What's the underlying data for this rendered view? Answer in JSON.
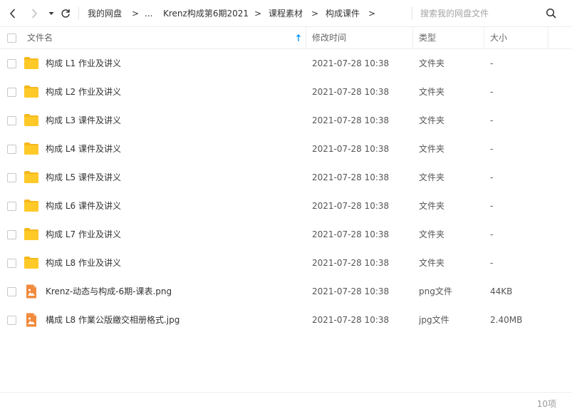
{
  "nav": {
    "back_icon": "chevron-left-icon",
    "forward_icon": "chevron-right-icon",
    "history_icon": "caret-down-icon",
    "refresh_icon": "refresh-icon"
  },
  "breadcrumb": {
    "items": [
      "我的网盘",
      "...",
      "Krenz构成第6期2021",
      "课程素材",
      "构成课件"
    ],
    "separator": ">"
  },
  "search": {
    "placeholder": "搜索我的网盘文件",
    "icon": "search-icon"
  },
  "columns": {
    "name": "文件名",
    "mtime": "修改时间",
    "type": "类型",
    "size": "大小",
    "sort_icon": "sort-ascending-arrow-icon"
  },
  "files": [
    {
      "name": "构成 L1 作业及讲义",
      "mtime": "2021-07-28 10:38",
      "type": "文件夹",
      "size": "-",
      "icon": "folder-icon"
    },
    {
      "name": "构成 L2 作业及讲义",
      "mtime": "2021-07-28 10:38",
      "type": "文件夹",
      "size": "-",
      "icon": "folder-icon"
    },
    {
      "name": "构成 L3 课件及讲义",
      "mtime": "2021-07-28 10:38",
      "type": "文件夹",
      "size": "-",
      "icon": "folder-icon"
    },
    {
      "name": "构成 L4 课件及讲义",
      "mtime": "2021-07-28 10:38",
      "type": "文件夹",
      "size": "-",
      "icon": "folder-icon"
    },
    {
      "name": "构成 L5 课件及讲义",
      "mtime": "2021-07-28 10:38",
      "type": "文件夹",
      "size": "-",
      "icon": "folder-icon"
    },
    {
      "name": "构成 L6 课件及讲义",
      "mtime": "2021-07-28 10:38",
      "type": "文件夹",
      "size": "-",
      "icon": "folder-icon"
    },
    {
      "name": "构成 L7 作业及讲义",
      "mtime": "2021-07-28 10:38",
      "type": "文件夹",
      "size": "-",
      "icon": "folder-icon"
    },
    {
      "name": "构成 L8 作业及讲义",
      "mtime": "2021-07-28 10:38",
      "type": "文件夹",
      "size": "-",
      "icon": "folder-icon"
    },
    {
      "name": "Krenz-动态与构成-6期-课表.png",
      "mtime": "2021-07-28 10:38",
      "type": "png文件",
      "size": "44KB",
      "icon": "image-file-icon"
    },
    {
      "name": "構成 L8 作業公版繳交相册格式.jpg",
      "mtime": "2021-07-28 10:38",
      "type": "jpg文件",
      "size": "2.40MB",
      "icon": "image-file-icon"
    }
  ],
  "footer": {
    "count": "10项"
  },
  "colors": {
    "folder": "#FFCA28",
    "folder_tab": "#F5B81C",
    "image_file": "#F08A3C",
    "sort_arrow": "#1E9FFF",
    "divider": "#EEEEEE"
  }
}
